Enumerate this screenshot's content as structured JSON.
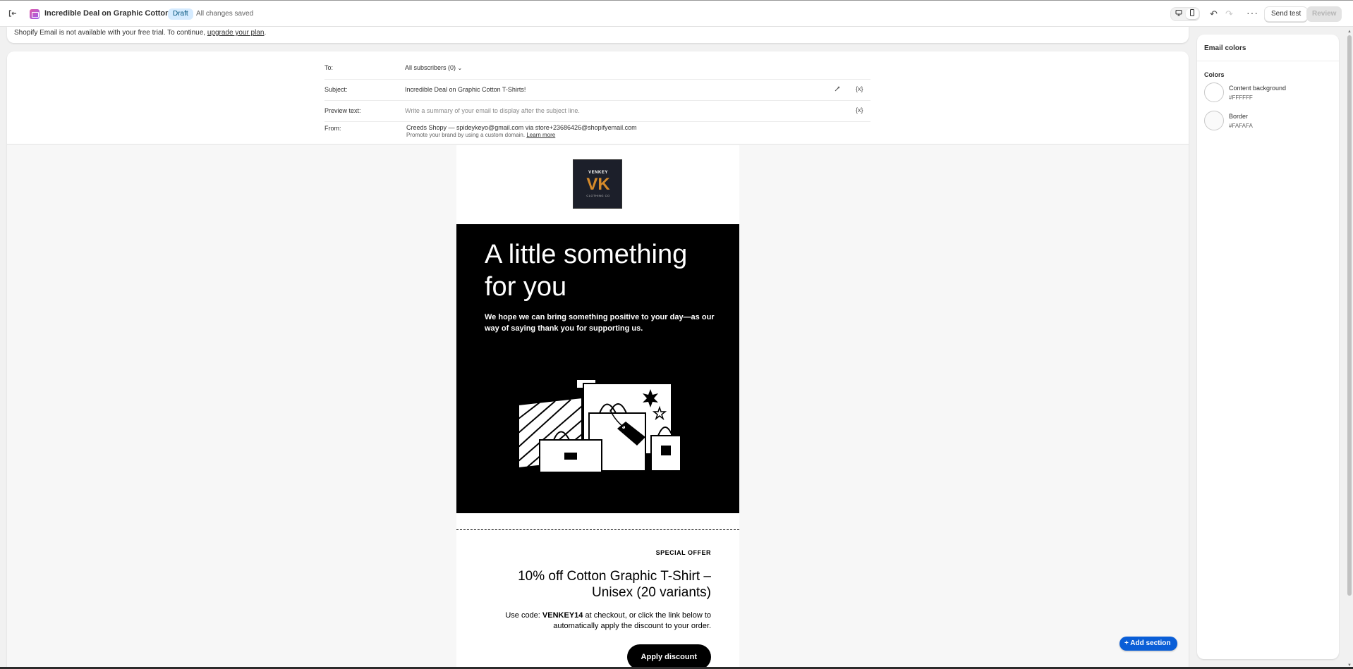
{
  "topbar": {
    "title": "Incredible Deal on Graphic Cotton T-...",
    "status_badge": "Draft",
    "save_status": "All changes saved",
    "send_test_label": "Send test",
    "review_label": "Review"
  },
  "banner": {
    "text": "Shopify Email is not available with your free trial. To continue, ",
    "link": "upgrade your plan",
    "suffix": "."
  },
  "meta": {
    "to_label": "To:",
    "to_value": "All subscribers (0)",
    "subject_label": "Subject:",
    "subject_value": "Incredible Deal on Graphic Cotton T-Shirts!",
    "preview_label": "Preview text:",
    "preview_placeholder": "Write a summary of your email to display after the subject line.",
    "from_label": "From:",
    "from_value": "Creeds Shopy — spideykeyo@gmail.com via store+23686426@shopifyemail.com",
    "from_hint": "Promote your brand by using a custom domain. ",
    "from_link": "Learn more",
    "variable_icon": "{x}"
  },
  "email": {
    "logo_top": "VENKEY",
    "logo_mark": "VK",
    "logo_bottom": "CLOTHING CO",
    "hero_title": "A little something for you",
    "hero_body": "We hope we can bring something positive to your day—as our way of saying thank you for supporting us.",
    "offer_label": "SPECIAL OFFER",
    "offer_title": "10% off Cotton Graphic T-Shirt – Unisex (20 variants)",
    "offer_prefix": "Use code: ",
    "offer_code": "VENKEY14",
    "offer_suffix": " at checkout, or click the link below to automatically apply the discount to your order.",
    "button_label": "Apply discount"
  },
  "add_section_label": "+ Add section",
  "side_panel": {
    "title": "Email colors",
    "section": "Colors",
    "colors": [
      {
        "name": "Content background",
        "hex": "#FFFFFF"
      },
      {
        "name": "Border",
        "hex": "#FAFAFA"
      }
    ]
  },
  "icons": {
    "exit": "exit-icon",
    "desktop": "desktop-icon",
    "mobile": "mobile-icon",
    "undo": "undo-icon",
    "redo": "redo-icon",
    "more": "more-icon",
    "chevron": "chevron-down-icon",
    "ai": "magic-icon"
  },
  "colors": {
    "accent": "#0a5ed7",
    "badge_bg": "#d5ebff",
    "hero_bg": "#000000"
  }
}
